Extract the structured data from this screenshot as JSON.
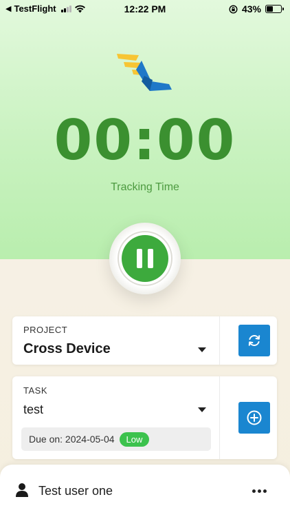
{
  "status_bar": {
    "back_label": "TestFlight",
    "time": "12:22 PM",
    "battery_percent": "43%",
    "battery_level": 0.43,
    "icons": [
      "back-arrow-icon",
      "cellular-signal-icon",
      "wifi-icon",
      "orientation-lock-icon",
      "battery-icon"
    ]
  },
  "timer": {
    "display": "00:00",
    "label": "Tracking Time",
    "color": "#3b9030"
  },
  "controls": {
    "pause_icon": "pause-icon",
    "accent": "#3daa3d"
  },
  "project": {
    "label": "PROJECT",
    "value": "Cross Device",
    "action_icon": "refresh-icon"
  },
  "task": {
    "label": "TASK",
    "value": "test",
    "due_text": "Due on: 2024-05-04",
    "priority": "Low",
    "priority_color": "#3cc24d",
    "action_icon": "add-circle-icon"
  },
  "user": {
    "name": "Test user one",
    "avatar_icon": "user-icon",
    "menu_icon": "more-horizontal-icon"
  },
  "colors": {
    "button_blue": "#1a86d0"
  }
}
